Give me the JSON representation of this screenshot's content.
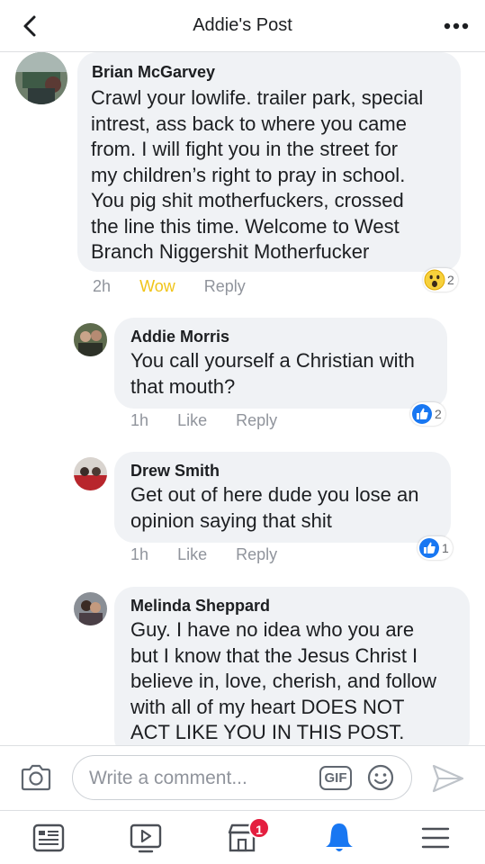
{
  "header": {
    "title": "Addie's Post"
  },
  "comments": [
    {
      "author": "Brian McGarvey",
      "lines": [
        "Crawl your lowlife. trailer park, special",
        "intrest, ass back to where you came",
        "from. I will fight you in the street for",
        "my children’s right to pray in school.",
        "You pig shit motherfuckers, crossed",
        "the line this time. Welcome to West",
        "Branch Niggershit Motherfucker"
      ],
      "time": "2h",
      "reaction_label": "Wow",
      "reply_label": "Reply",
      "reaction_icon": "wow-emoji-icon",
      "reaction_count": "2"
    },
    {
      "author": "Addie Morris",
      "lines": [
        "You call yourself a Christian with",
        "that mouth?"
      ],
      "time": "1h",
      "like_label": "Like",
      "reply_label": "Reply",
      "reaction_icon": "like-thumb-icon",
      "reaction_count": "2"
    },
    {
      "author": "Drew Smith",
      "lines": [
        "Get out of here dude you lose an",
        "opinion saying that shit"
      ],
      "time": "1h",
      "like_label": "Like",
      "reply_label": "Reply",
      "reaction_icon": "like-thumb-icon",
      "reaction_count": "1"
    },
    {
      "author": "Melinda Sheppard",
      "lines": [
        "Guy. I have no idea who you are",
        "but I know that the Jesus Christ I",
        "believe in, love, cherish, and follow",
        "with all of my heart DOES NOT",
        "ACT LIKE YOU IN THIS POST."
      ]
    }
  ],
  "composer": {
    "placeholder": "Write a comment...",
    "gif_label": "GIF"
  },
  "tabbar": {
    "items": [
      "news-feed-icon",
      "watch-video-icon",
      "marketplace-icon",
      "notifications-bell-icon",
      "menu-hamburger-icon"
    ],
    "marketplace_badge": "1"
  },
  "colors": {
    "accent": "#1877f2",
    "wow_label": "#f0c419",
    "bubble": "#f0f2f5",
    "meta_text": "#90949c",
    "badge": "#e41e3f"
  }
}
